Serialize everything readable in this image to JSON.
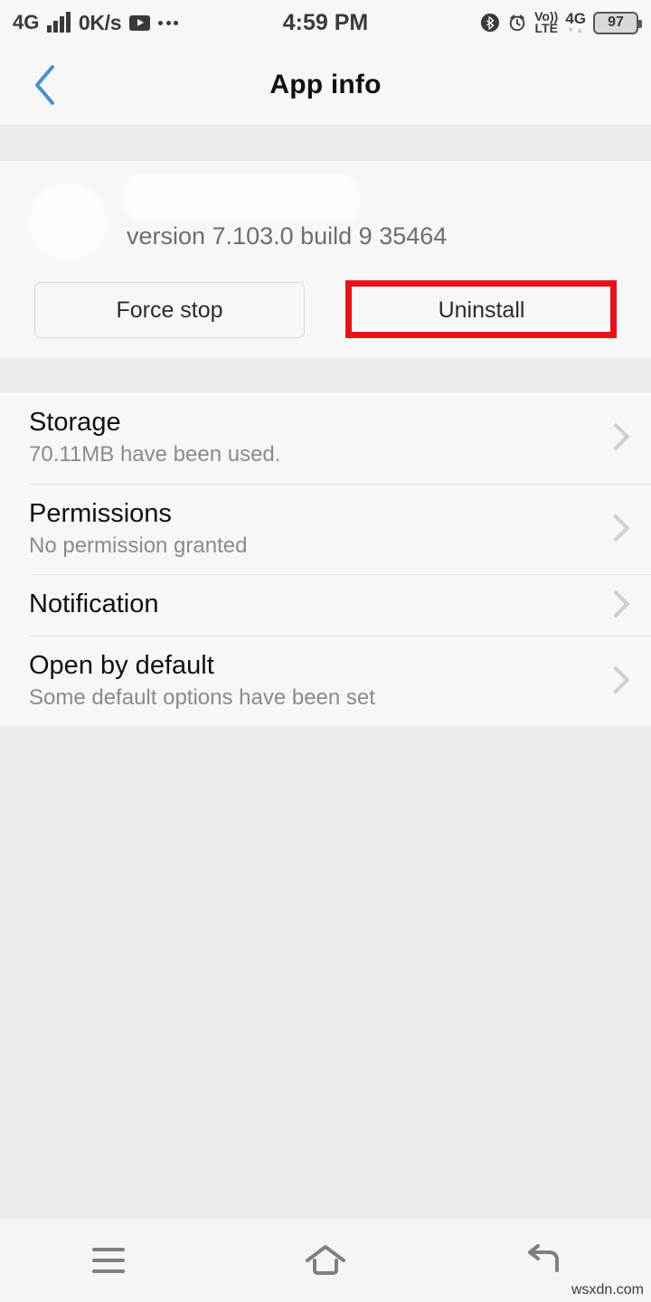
{
  "status_bar": {
    "network_label": "4G",
    "data_rate": "0K/s",
    "media_icon": "youtube-play-icon",
    "overflow_icon": "more-dots-icon",
    "clock": "4:59 PM",
    "bluetooth_icon": "bluetooth-icon",
    "alarm_icon": "alarm-clock-icon",
    "volte_top": "Vo))",
    "volte_bottom": "LTE",
    "network_right": "4G",
    "data_arrows": "▼▲",
    "battery_level": "97"
  },
  "title_bar": {
    "back_icon": "back-chevron-icon",
    "title": "App info",
    "back_color": "#4a90d0"
  },
  "app_header": {
    "icon": "app-icon-redacted",
    "app_name": "",
    "app_name_redacted": true,
    "version": "version 7.103.0 build 9 35464"
  },
  "actions": {
    "force_stop_label": "Force stop",
    "uninstall_label": "Uninstall",
    "annotation": {
      "target": "uninstall-button",
      "color": "#e8131a",
      "shape": "rectangle"
    }
  },
  "settings_list": [
    {
      "title": "Storage",
      "subtitle": "70.11MB have been used.",
      "chevron": "chevron-right-icon"
    },
    {
      "title": "Permissions",
      "subtitle": "No permission granted",
      "chevron": "chevron-right-icon"
    },
    {
      "title": "Notification",
      "subtitle": "",
      "chevron": "chevron-right-icon"
    },
    {
      "title": "Open by default",
      "subtitle": "Some default options have been set",
      "chevron": "chevron-right-icon"
    }
  ],
  "nav_bar": {
    "menu_icon": "menu-icon",
    "home_icon": "home-icon",
    "back_icon": "back-arrow-icon"
  },
  "watermark": "wsxdn.com"
}
